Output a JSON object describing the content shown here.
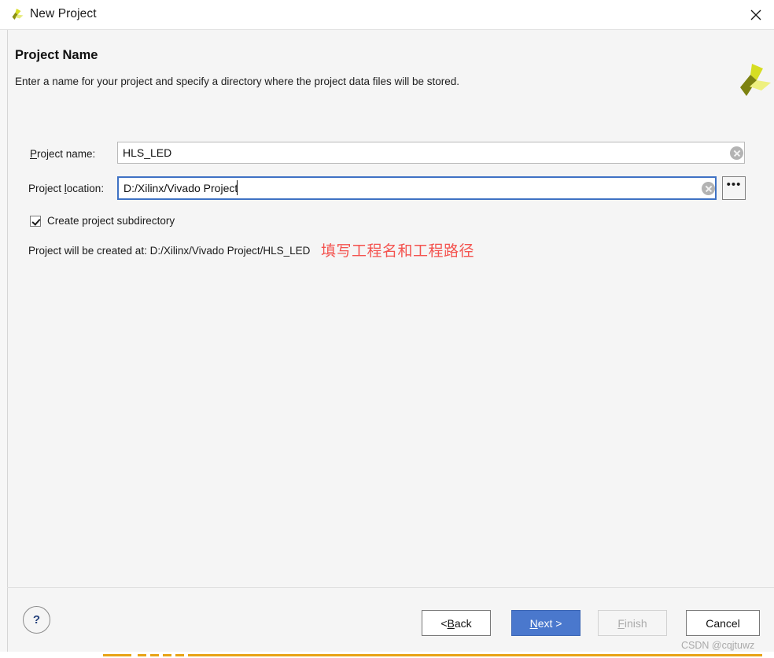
{
  "window": {
    "title": "New Project",
    "app_icon": "vivado-logo-icon",
    "close_icon": "close-icon"
  },
  "header": {
    "title": "Project Name",
    "subtitle": "Enter a name for your project and specify a directory where the project data files will be stored.",
    "brand_logo": "xilinx-logo-icon"
  },
  "form": {
    "project_name": {
      "label_prefix": "",
      "label_mnemonic": "P",
      "label_suffix": "roject name:",
      "value": "HLS_LED",
      "clear_icon": "clear-circle-icon"
    },
    "project_location": {
      "label_prefix": "Project ",
      "label_mnemonic": "l",
      "label_suffix": "ocation:",
      "value": "D:/Xilinx/Vivado Project",
      "clear_icon": "clear-circle-icon",
      "browse_label": "•••"
    },
    "create_subdirectory": {
      "label": "Create project subdirectory",
      "checked": true
    },
    "created_at": "Project will be created at: D:/Xilinx/Vivado Project/HLS_LED"
  },
  "annotation": {
    "text": "填写工程名和工程路径",
    "color": "#f4534f"
  },
  "footer": {
    "help_label": "?",
    "buttons": {
      "back": {
        "prefix": "< ",
        "mnemonic": "B",
        "suffix": "ack"
      },
      "next": {
        "prefix": "",
        "mnemonic": "N",
        "suffix": "ext >"
      },
      "finish": {
        "prefix": "",
        "mnemonic": "F",
        "suffix": "inish",
        "disabled": true
      },
      "cancel": {
        "prefix": "Cancel",
        "mnemonic": "",
        "suffix": ""
      }
    },
    "watermark": "CSDN @cqjtuwz"
  },
  "colors": {
    "accent_blue": "#4a78cd",
    "focus_border": "#3f72c4",
    "annotation_red": "#f4534f",
    "logo_green": "#d6dd22",
    "logo_olive": "#7d8211",
    "dialog_bg": "#f5f5f5"
  }
}
